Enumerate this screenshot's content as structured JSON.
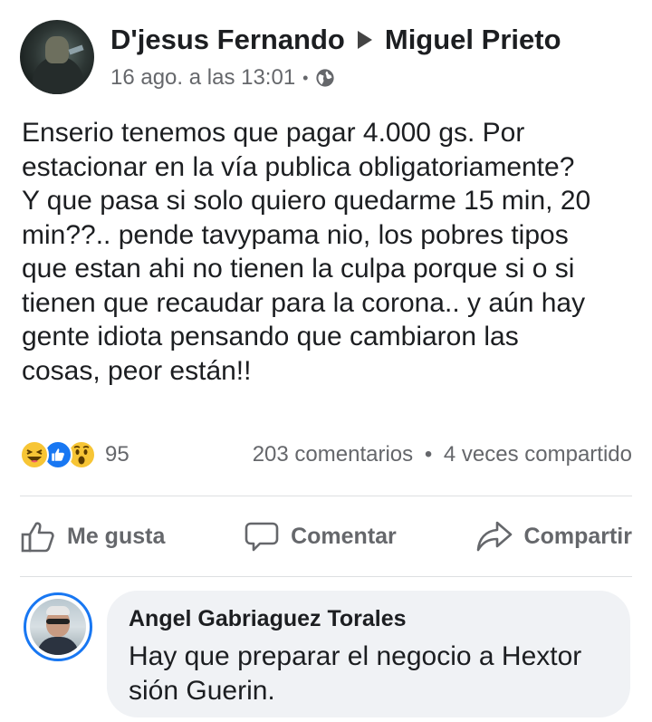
{
  "post": {
    "author": "D'jesus Fernando",
    "recipient": "Miguel Prieto",
    "timestamp": "16 ago. a las 13:01",
    "meta_separator": "•",
    "privacy_icon": "globe-icon",
    "text_lines": [
      "Enserio tenemos que pagar 4.000 gs. Por",
      "estacionar en la vía publica obligatoriamente?",
      "Y que pasa si solo quiero quedarme 15 min, 20",
      "min??.. pende tavypama nio, los pobres tipos",
      "que estan ahi no tienen la culpa porque si o si",
      "tienen que recaudar para la corona.. y aún hay",
      "gente idiota pensando que cambiaron las",
      "cosas, peor están!!"
    ]
  },
  "stats": {
    "reaction_icons": [
      "haha-icon",
      "like-icon",
      "wow-icon"
    ],
    "reaction_count": "95",
    "comments": "203 comentarios",
    "separator": "•",
    "shares": "4 veces compartido"
  },
  "actions": {
    "like_label": "Me gusta",
    "comment_label": "Comentar",
    "share_label": "Compartir"
  },
  "comment": {
    "author": "Angel Gabriaguez Torales",
    "text_lines": [
      "Hay que preparar el negocio a Hextor",
      "sión Guerin."
    ]
  },
  "colors": {
    "text": "#1c1e21",
    "secondary": "#65676b",
    "accent": "#1877f2",
    "bubble": "#f0f2f5"
  }
}
